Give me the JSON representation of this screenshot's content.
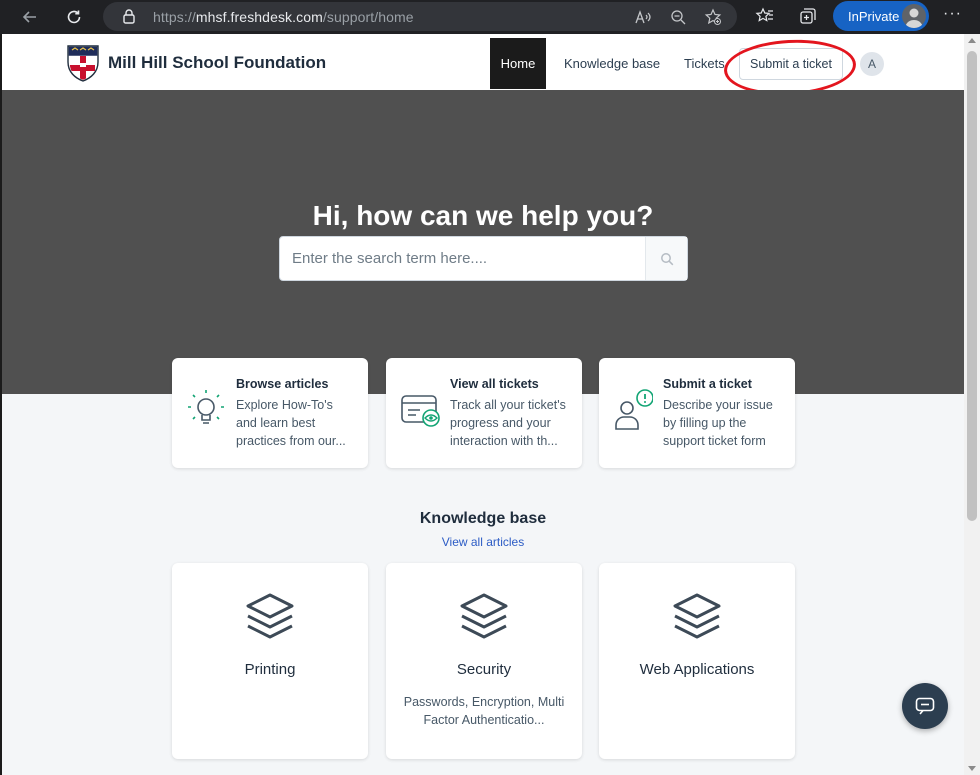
{
  "browser": {
    "url_prefix": "https://",
    "url_domain": "mhsf.freshdesk.com",
    "url_path": "/support/home",
    "inprivate_label": "InPrivate",
    "menu_label": "···"
  },
  "header": {
    "site_title": "Mill Hill School Foundation",
    "nav": {
      "home": "Home",
      "knowledge_base": "Knowledge base",
      "tickets": "Tickets",
      "submit_ticket": "Submit a ticket"
    },
    "user_initial": "A"
  },
  "hero": {
    "title": "Hi, how can we help you?",
    "search_placeholder": "Enter the search term here...."
  },
  "quick_links": [
    {
      "title": "Browse articles",
      "description": "Explore How-To's and learn best practices from our..."
    },
    {
      "title": "View all tickets",
      "description": "Track all your ticket's progress and your interaction with th..."
    },
    {
      "title": "Submit a ticket",
      "description": "Describe your issue by filling up the support ticket form"
    }
  ],
  "knowledge_base": {
    "title": "Knowledge base",
    "view_all": "View all articles",
    "categories": [
      {
        "title": "Printing",
        "description": ""
      },
      {
        "title": "Security",
        "description": "Passwords, Encryption, Multi Factor Authenticatio..."
      },
      {
        "title": "Web Applications",
        "description": ""
      }
    ]
  },
  "colors": {
    "hero_bg": "#505050",
    "accent_green": "#12a474",
    "annotation_red": "#e3151e",
    "link_blue": "#2c5cc5"
  }
}
